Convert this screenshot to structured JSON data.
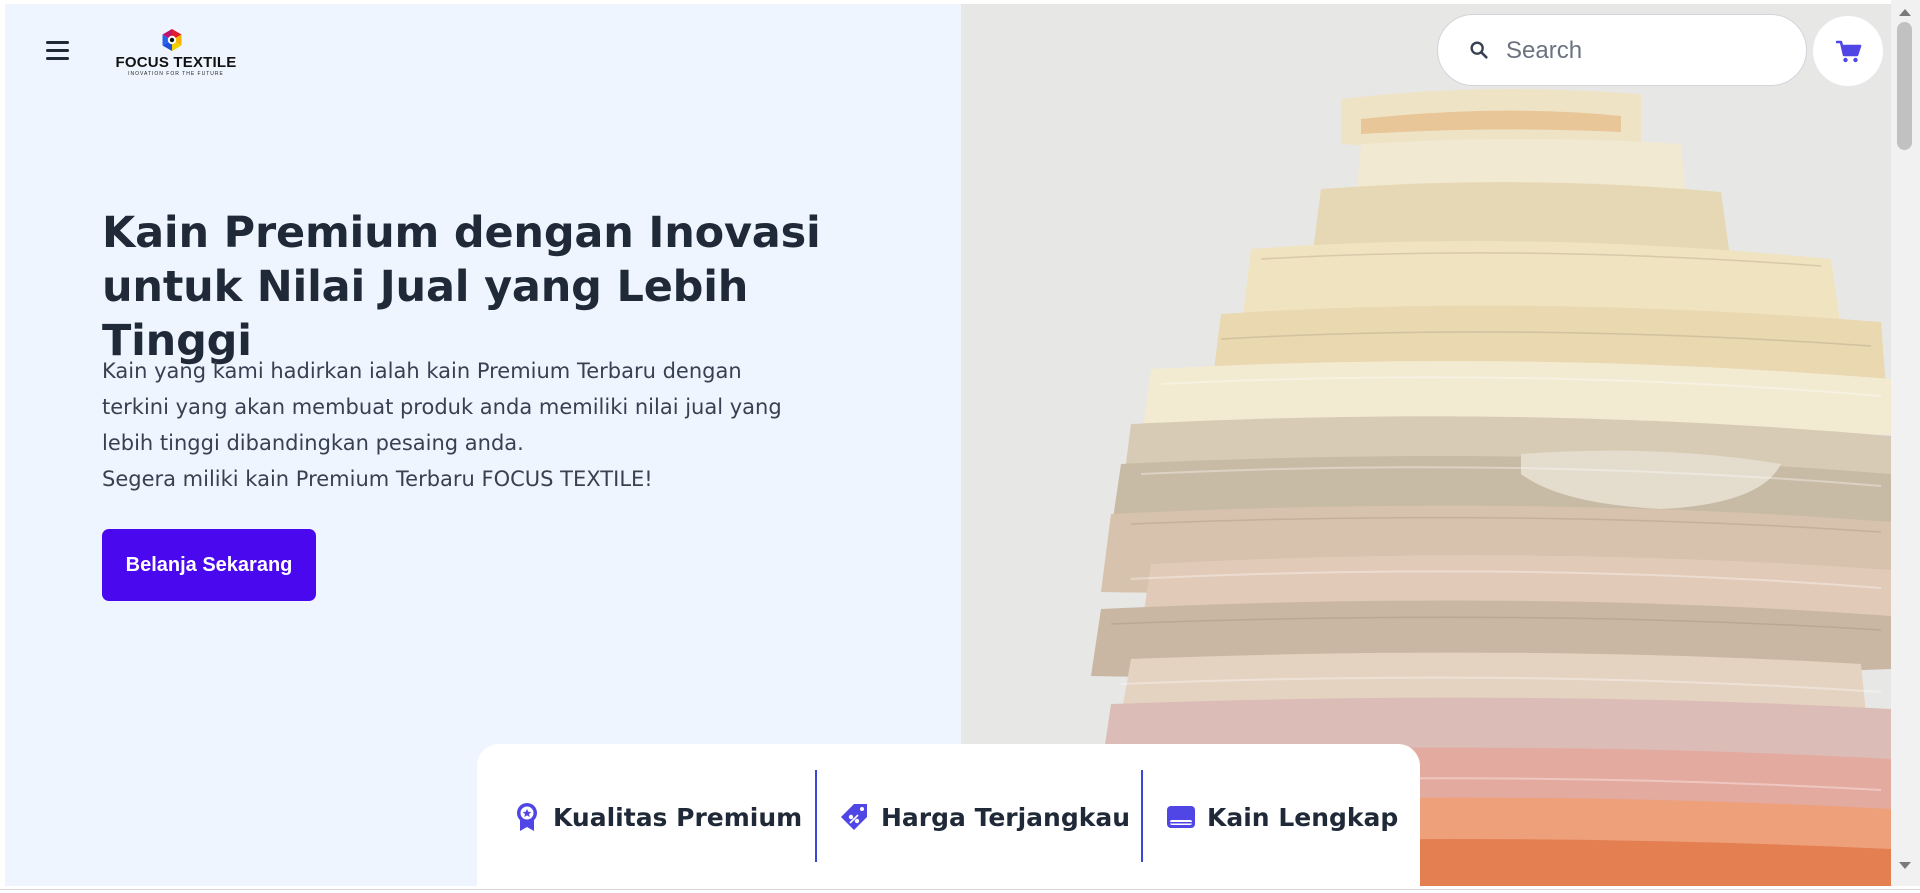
{
  "header": {
    "menu_icon": "hamburger-icon",
    "logo": {
      "name": "FOCUS TEXTILE",
      "tagline": "INOVATION FOR THE FUTURE"
    },
    "search": {
      "placeholder": "Search",
      "value": "",
      "icon": "search-icon"
    },
    "cart": {
      "icon": "cart-icon"
    }
  },
  "hero": {
    "title_line1": "Kain Premium dengan Inovasi",
    "title_line2": "untuk Nilai Jual yang Lebih Tinggi",
    "description_lines": [
      "Kain yang kami hadirkan ialah kain Premium Terbaru dengan",
      "terkini yang akan membuat produk anda memiliki nilai jual yang",
      "lebih tinggi dibandingkan pesaing anda.",
      "Segera miliki kain Premium Terbaru FOCUS TEXTILE!"
    ],
    "cta_label": "Belanja Sekarang",
    "image": "stack-of-folded-fabrics"
  },
  "features": [
    {
      "icon": "award-badge-icon",
      "label": "Kualitas Premium"
    },
    {
      "icon": "price-tag-icon",
      "label": "Harga Terjangkau"
    },
    {
      "icon": "fabric-roll-icon",
      "label": "Kain Lengkap"
    }
  ],
  "colors": {
    "page_bg": "#eff5ff",
    "accent": "#4a08ef",
    "icon_accent": "#4f46e5",
    "divider": "#3b47d6",
    "heading": "#1f2937"
  }
}
